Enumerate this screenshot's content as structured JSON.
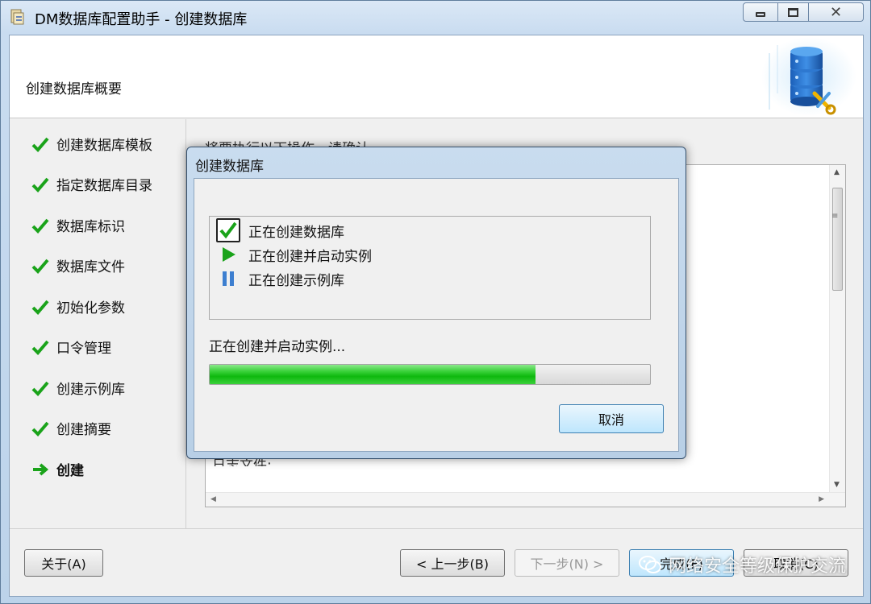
{
  "window": {
    "title": "DM数据库配置助手 - 创建数据库",
    "minimize_icon": "minimize-icon",
    "maximize_icon": "maximize-icon",
    "close_glyph": "✕"
  },
  "header": {
    "title": "创建数据库概要",
    "graphic_icon": "database-tools-icon"
  },
  "steps": [
    {
      "label": "创建数据库模板",
      "status": "done"
    },
    {
      "label": "指定数据库目录",
      "status": "done"
    },
    {
      "label": "数据库标识",
      "status": "done"
    },
    {
      "label": "数据库文件",
      "status": "done"
    },
    {
      "label": "初始化参数",
      "status": "done"
    },
    {
      "label": "口令管理",
      "status": "done"
    },
    {
      "label": "创建示例库",
      "status": "done"
    },
    {
      "label": "创建摘要",
      "status": "done"
    },
    {
      "label": "创建",
      "status": "current"
    }
  ],
  "summary": {
    "caption": "将要执行以下操作，请确认",
    "last_line": "日志文件:"
  },
  "footer": {
    "about_label": "关于(A)",
    "back_label": "< 上一步(B)",
    "next_label": "下一步(N) >",
    "finish_label": "完成(F)",
    "cancel_label": "取消(C)"
  },
  "dialog": {
    "title": "创建数据库",
    "tasks": [
      {
        "label": "正在创建数据库",
        "state": "done"
      },
      {
        "label": "正在创建并启动实例",
        "state": "running"
      },
      {
        "label": "正在创建示例库",
        "state": "paused"
      }
    ],
    "status_text": "正在创建并启动实例...",
    "progress_percent": 74,
    "cancel_label": "取消"
  },
  "colors": {
    "check_green": "#1aa31a",
    "play_green": "#1aa31a",
    "pause_blue": "#3d7fd0",
    "arrow_green": "#1aa31a"
  },
  "watermark": {
    "text": "网络安全等级保护交流",
    "icon": "wechat-icon"
  }
}
